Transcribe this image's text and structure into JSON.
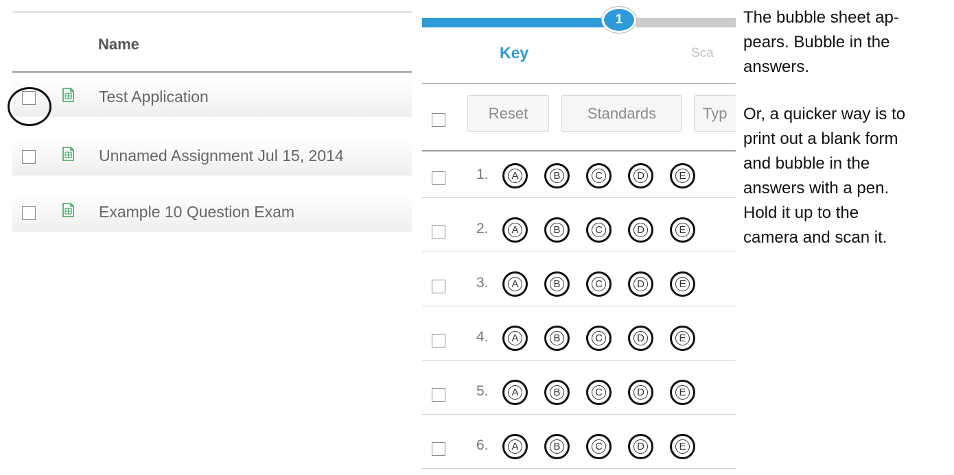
{
  "assignments": {
    "header": "Name",
    "rows": [
      {
        "name": "Test Application"
      },
      {
        "name": "Unnamed Assignment Jul 15, 2014"
      },
      {
        "name": "Example 10 Question Exam"
      }
    ]
  },
  "key_panel": {
    "stepper": {
      "current_step": "1",
      "step_1_label": "Key",
      "step_2_label": "Sca"
    },
    "toolbar": {
      "reset": "Reset",
      "standards": "Standards",
      "type_partial": "Typ"
    },
    "choices": [
      "A",
      "B",
      "C",
      "D",
      "E"
    ],
    "questions": [
      "1.",
      "2.",
      "3.",
      "4.",
      "5.",
      "6."
    ]
  },
  "instructions": {
    "paragraph_1": "The bubble sheet ap-\npears. Bubble in the\nanswers.",
    "paragraph_2": "Or, a quicker way is to\nprint out a blank form\nand bubble in the\nanswers with a pen.\nHold it up to the\ncamera and scan it."
  },
  "colors": {
    "accent": "#2e9bd8",
    "doc_icon": "#3aa757"
  }
}
